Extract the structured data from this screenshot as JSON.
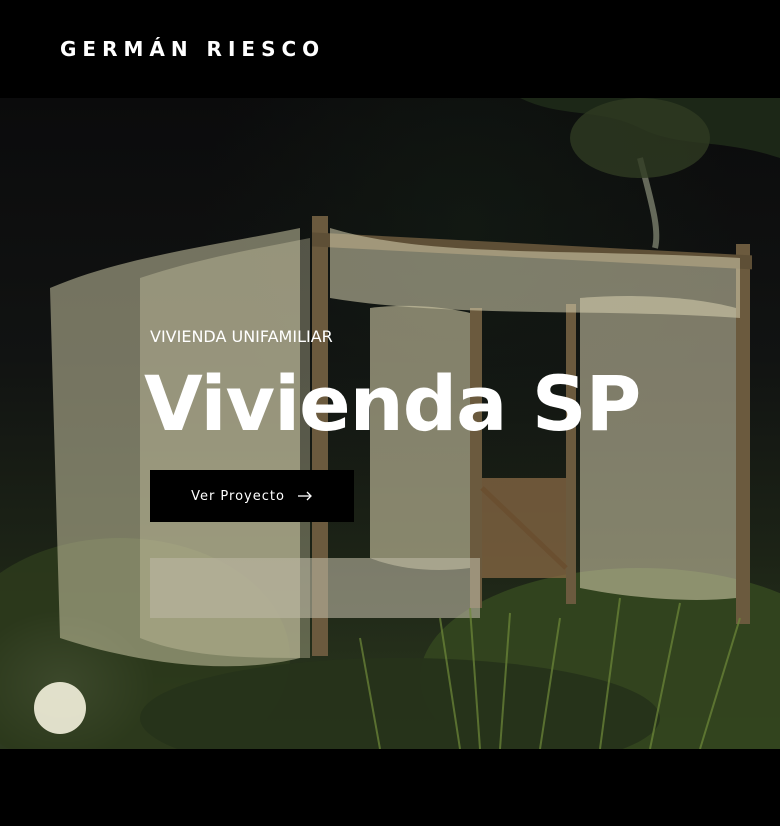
{
  "header": {
    "logo": "GERMÁN RIESCO"
  },
  "hero": {
    "category": "VIVIENDA UNIFAMILIAR",
    "title": "Vivienda SP",
    "cta_label": "Ver Proyecto",
    "cta_icon": "arrow-right-icon",
    "image_description_colors": {
      "sky": "#0b0b0c",
      "foliage": "#3b4a26",
      "netting": "#d6d1b0",
      "frame": "#6b5a3e"
    }
  }
}
